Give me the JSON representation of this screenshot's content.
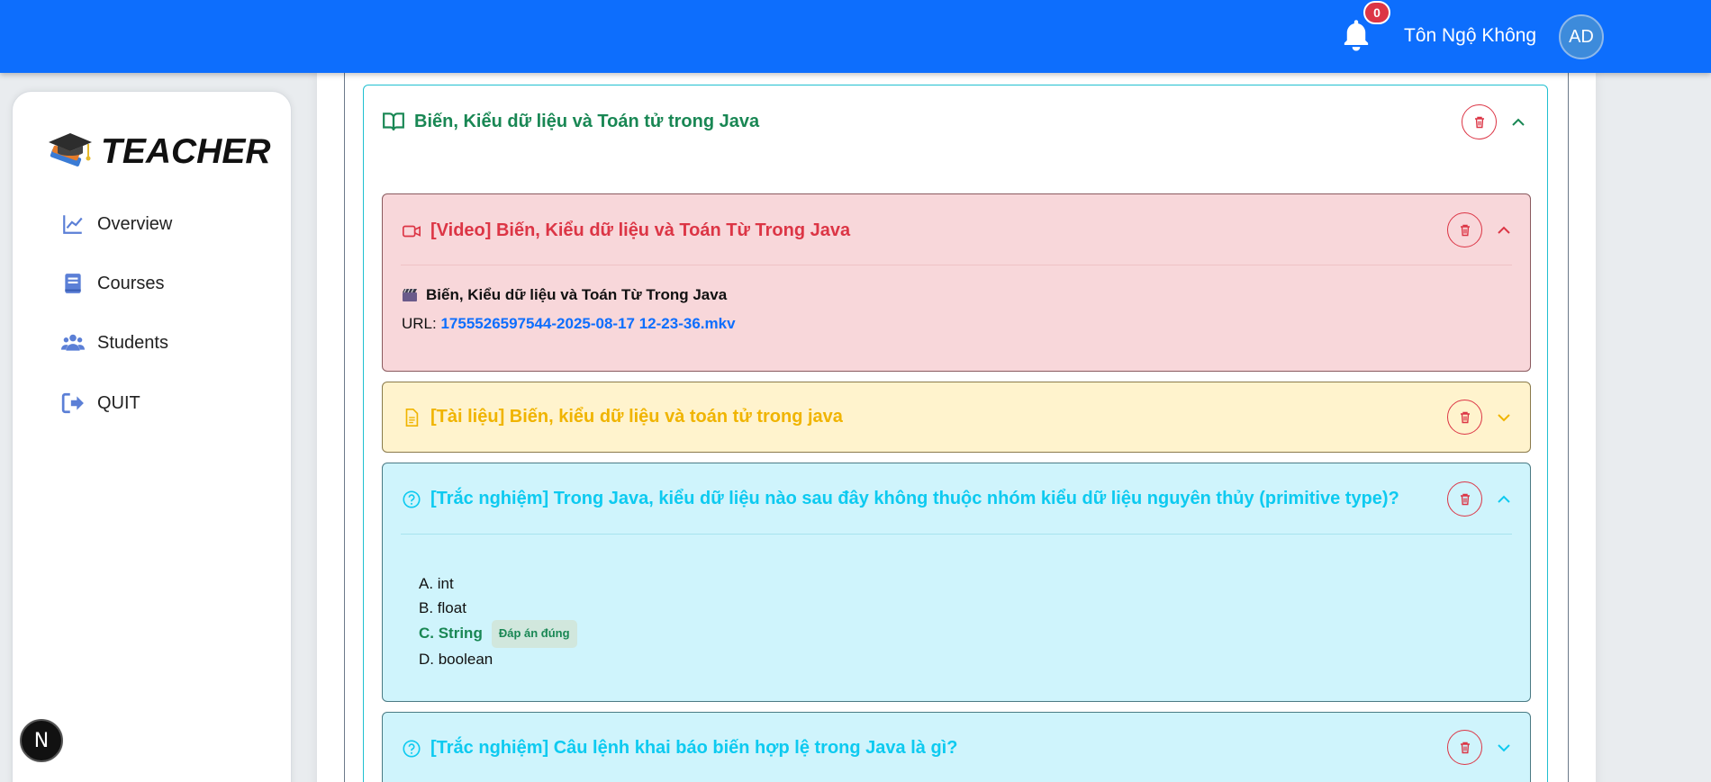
{
  "header": {
    "notification_count": "0",
    "user_name": "Tôn Ngộ Không",
    "avatar_initials": "AD"
  },
  "sidebar": {
    "brand": "TEACHER",
    "items": [
      {
        "label": "Overview",
        "icon": "chart-line-icon"
      },
      {
        "label": "Courses",
        "icon": "book-icon"
      },
      {
        "label": "Students",
        "icon": "users-icon"
      },
      {
        "label": "QUIT",
        "icon": "sign-out-icon"
      }
    ]
  },
  "floating_badge": "N",
  "section": {
    "title": "Biến, Kiểu dữ liệu và Toán tử trong Java",
    "lessons": [
      {
        "type": "video",
        "title": "[Video] Biến, Kiểu dữ liệu và Toán Từ Trong Java",
        "file_name": "Biến, Kiểu dữ liệu và Toán Từ Trong Java",
        "url_label": "URL:",
        "url": "1755526597544-2025-08-17 12-23-36.mkv",
        "expanded": true
      },
      {
        "type": "document",
        "title": "[Tài liệu] Biến, kiểu dữ liệu và toán tử trong java",
        "expanded": false
      },
      {
        "type": "quiz",
        "title": "[Trắc nghiệm] Trong Java, kiểu dữ liệu nào sau đây không thuộc nhóm kiểu dữ liệu nguyên thủy (primitive type)?",
        "options": [
          "A. int",
          "B. float",
          "C. String",
          "D. boolean"
        ],
        "correct_badge": "Đáp án đúng",
        "expanded": true
      },
      {
        "type": "quiz",
        "title": "[Trắc nghiệm] Câu lệnh khai báo biến hợp lệ trong Java là gì?",
        "expanded": false
      }
    ]
  },
  "colors": {
    "primary": "#0d6efd",
    "danger": "#dc3545",
    "success": "#198754",
    "warning": "#ffc107",
    "info": "#0dcaf0"
  }
}
